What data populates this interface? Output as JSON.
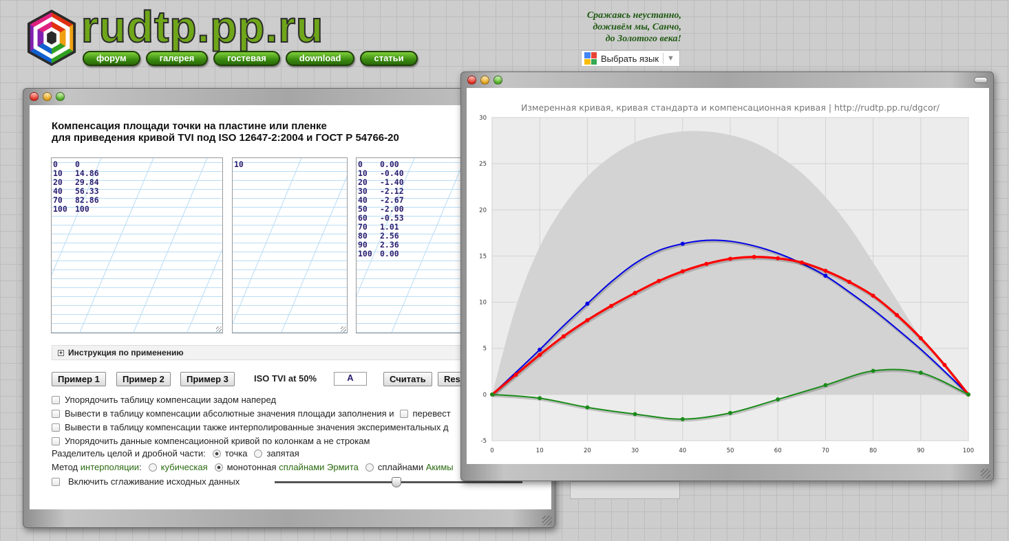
{
  "header": {
    "brand": "rudtp.pp.ru",
    "nav": [
      "форум",
      "галерея",
      "гостевая",
      "download",
      "статьи"
    ],
    "quote": [
      "Сражаясь неустанно,",
      "доживём мы, Санчо,",
      "до Золотого века!"
    ],
    "language_button": "Выбрать язык"
  },
  "form": {
    "title_line1": "Компенсация площади точки на пластине или пленке",
    "title_line2": "для приведения кривой TVI под ISO 12647-2:2004 и ГОСТ Р 54766-20",
    "input_table": [
      [
        "0",
        "0"
      ],
      [
        "10",
        "14.86"
      ],
      [
        "20",
        "29.84"
      ],
      [
        "40",
        "56.33"
      ],
      [
        "70",
        "82.86"
      ],
      [
        "100",
        "100"
      ]
    ],
    "middle_table": [
      [
        "10"
      ]
    ],
    "result_table": [
      [
        "0",
        "0.00"
      ],
      [
        "10",
        "-0.40"
      ],
      [
        "20",
        "-1.40"
      ],
      [
        "30",
        "-2.12"
      ],
      [
        "40",
        "-2.67"
      ],
      [
        "50",
        "-2.00"
      ],
      [
        "60",
        "-0.53"
      ],
      [
        "70",
        "1.01"
      ],
      [
        "80",
        "2.56"
      ],
      [
        "90",
        "2.36"
      ],
      [
        "100",
        "0.00"
      ]
    ],
    "instructions": "Инструкция по применению",
    "buttons": {
      "ex1": "Пример 1",
      "ex2": "Пример 2",
      "ex3": "Пример 3",
      "calc": "Считать",
      "reset": "Res"
    },
    "iso_label": "ISO TVI at 50%",
    "iso_value": "A",
    "options": {
      "reverse": "Упорядочить таблицу компенсации задом наперед",
      "absolute": "Вывести в таблицу компенсации абсолютные значения площади заполнения и",
      "absolute_tail": "перевест",
      "interpolated": "Вывести в таблицу компенсации также интерполированные значения экспериментальных д",
      "columns": "Упорядочить данные компенсационной кривой по колонкам а не строкам",
      "separator_label": "Разделитель целой и дробной части:",
      "sep_dot": "точка",
      "sep_comma": "запятая",
      "method_label": "Метод",
      "method_link": "интерполяции",
      "cubic": "кубическая",
      "mono_prefix": "монотонная",
      "mono_link": "сплайнами Эрмита",
      "akima_prefix": "сплайнами",
      "akima_link": "Акимы",
      "smoothing": "Включить сглаживание исходных данных"
    }
  },
  "chart_data": {
    "type": "line",
    "title": "Измеренная кривая, кривая стандарта и компенсационная кривая | http://rudtp.pp.ru/dgcor/",
    "xlim": [
      0,
      100
    ],
    "ylim": [
      -5,
      30
    ],
    "xticks": [
      0,
      10,
      20,
      30,
      40,
      50,
      60,
      70,
      80,
      90,
      100
    ],
    "yticks": [
      -5,
      0,
      5,
      10,
      15,
      20,
      25,
      30
    ],
    "grid": true,
    "tolerance_band": {
      "x": [
        0,
        5,
        10,
        15,
        20,
        25,
        30,
        35,
        40,
        45,
        50,
        55,
        60,
        65,
        70,
        75,
        80,
        85,
        90,
        95,
        100
      ],
      "lower": [
        0,
        0,
        0,
        0,
        0,
        0,
        0,
        0,
        0,
        0,
        0,
        0,
        0,
        0,
        0,
        0,
        0,
        0,
        0,
        0,
        0
      ],
      "upper": [
        0,
        9.5,
        16.0,
        20.4,
        23.6,
        25.8,
        27.3,
        28.1,
        28.5,
        28.5,
        28.1,
        27.3,
        25.9,
        24.0,
        21.4,
        18.2,
        14.3,
        10.2,
        6.1,
        2.6,
        0
      ],
      "color": "#d3d3d3"
    },
    "series": [
      {
        "color": "#0000e6",
        "x": [
          0,
          5,
          10,
          15,
          20,
          25,
          30,
          35,
          40,
          45,
          50,
          55,
          60,
          65,
          70,
          75,
          80,
          85,
          90,
          95,
          100
        ],
        "y": [
          0,
          2.4,
          4.86,
          7.45,
          9.84,
          12.2,
          14.2,
          15.6,
          16.33,
          16.7,
          16.6,
          16.1,
          15.3,
          14.2,
          12.86,
          11.1,
          9.2,
          7.1,
          4.9,
          2.5,
          0
        ],
        "markers_x": [
          10,
          20,
          40,
          70
        ],
        "markers_y": [
          4.86,
          9.84,
          16.33,
          12.86
        ]
      },
      {
        "color": "#ff0000",
        "x": [
          0,
          5,
          10,
          15,
          20,
          25,
          30,
          35,
          40,
          45,
          50,
          55,
          60,
          65,
          70,
          75,
          80,
          85,
          90,
          95,
          100
        ],
        "y": [
          0,
          2.15,
          4.3,
          6.3,
          8.05,
          9.6,
          11.0,
          12.3,
          13.35,
          14.15,
          14.7,
          14.9,
          14.75,
          14.3,
          13.4,
          12.2,
          10.7,
          8.6,
          6.1,
          3.2,
          0
        ]
      },
      {
        "color": "#1a8c1a",
        "x": [
          0,
          10,
          20,
          30,
          40,
          50,
          60,
          70,
          80,
          90,
          100
        ],
        "y": [
          0,
          -0.4,
          -1.4,
          -2.12,
          -2.67,
          -2.0,
          -0.53,
          1.01,
          2.56,
          2.36,
          0.0
        ]
      }
    ]
  }
}
